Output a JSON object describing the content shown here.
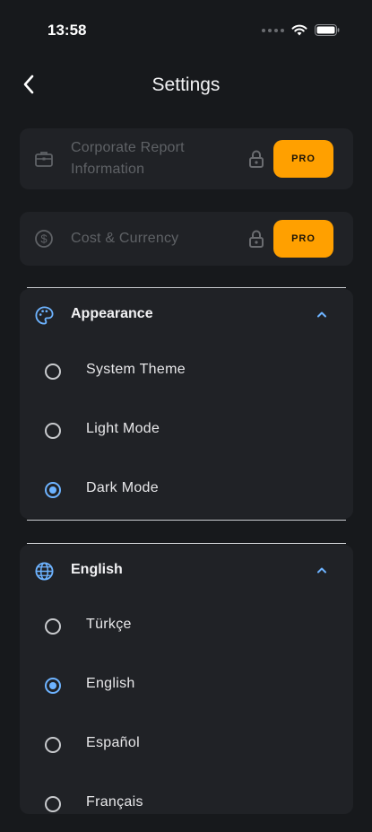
{
  "status": {
    "time": "13:58"
  },
  "nav": {
    "title": "Settings"
  },
  "pro_items": [
    {
      "label_line1": "Corporate Report",
      "label_line2": "Information",
      "badge": "PRO",
      "icon": "briefcase-icon"
    },
    {
      "label": "Cost & Currency",
      "badge": "PRO",
      "icon": "dollar-circle-icon"
    }
  ],
  "appearance": {
    "title": "Appearance",
    "icon": "palette-icon",
    "options": [
      {
        "label": "System Theme",
        "selected": false
      },
      {
        "label": "Light Mode",
        "selected": false
      },
      {
        "label": "Dark Mode",
        "selected": true
      }
    ]
  },
  "language": {
    "title": "English",
    "icon": "globe-icon",
    "options": [
      {
        "label": "Türkçe",
        "selected": false
      },
      {
        "label": "English",
        "selected": true
      },
      {
        "label": "Español",
        "selected": false
      },
      {
        "label": "Français",
        "selected": false
      }
    ]
  },
  "colors": {
    "accent": "#6db3ff",
    "pro": "#ffa000",
    "background": "#17191c",
    "card": "#202226"
  }
}
